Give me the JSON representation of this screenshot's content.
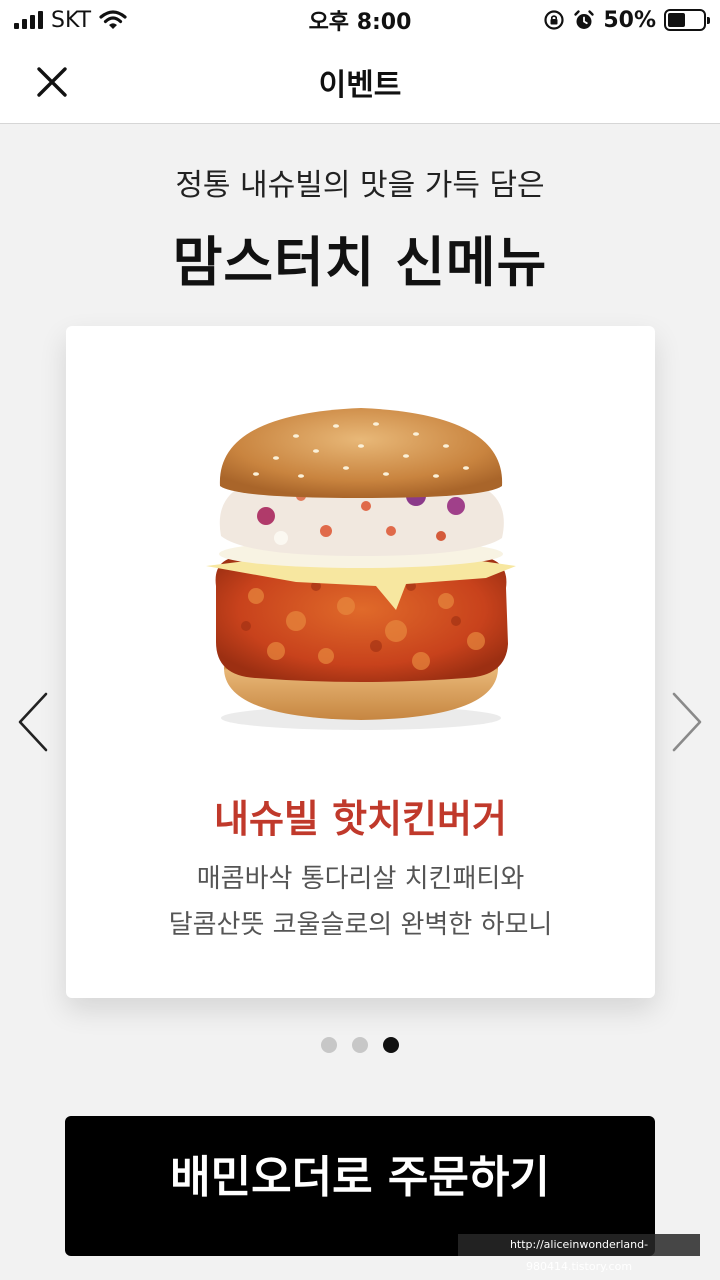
{
  "status_bar": {
    "carrier": "SKT",
    "time": "오후 8:00",
    "battery": "50%",
    "battery_level": 0.5
  },
  "header": {
    "title": "이벤트",
    "close_icon": "close-icon"
  },
  "intro": {
    "subtitle": "정통 내슈빌의 맛을 가득 담은",
    "headline": "맘스터치 신메뉴"
  },
  "carousel": {
    "product_name": "내슈빌 핫치킨버거",
    "description_lines": [
      "매콤바삭 통다리살 치킨패티와",
      "달콤산뜻 코울슬로의 완벽한 하모니"
    ],
    "slide_count": 3,
    "active_index": 2
  },
  "order_button": {
    "label": "배민오더로 주문하기"
  },
  "watermark": "http://aliceinwonderland-980414.tistory.com",
  "colors": {
    "accent_red": "#c0392b",
    "button_black": "#000000",
    "background": "#f2f2f2"
  }
}
